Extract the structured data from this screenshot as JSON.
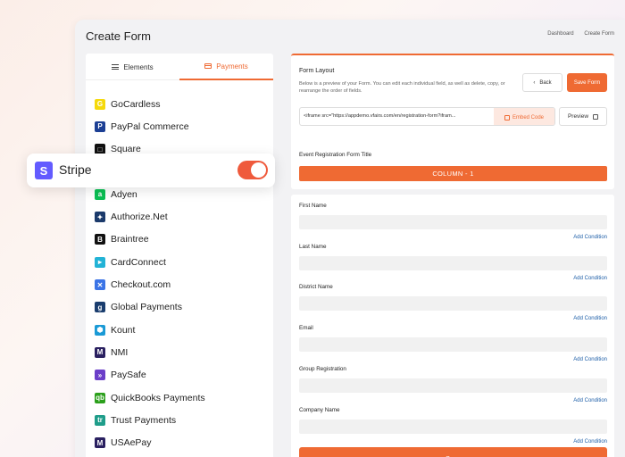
{
  "header": {
    "title": "Create Form",
    "breadcrumbs": [
      "Dashboard",
      "Create Form"
    ]
  },
  "tabs": {
    "elements": "Elements",
    "payments": "Payments"
  },
  "gateways": [
    {
      "name": "GoCardless",
      "icon": "gocardless-icon",
      "color": "#f5d90a",
      "glyph": "G"
    },
    {
      "name": "PayPal Commerce",
      "icon": "paypal-icon",
      "color": "#1c3f94",
      "glyph": "P"
    },
    {
      "name": "Square",
      "icon": "square-icon",
      "color": "#111111",
      "glyph": "□"
    },
    {
      "name": "Stripe",
      "icon": "stripe-icon",
      "color": "#635bff",
      "glyph": "S"
    },
    {
      "name": "Adyen",
      "icon": "adyen-icon",
      "color": "#0abf53",
      "glyph": "a"
    },
    {
      "name": "Authorize.Net",
      "icon": "authorize-net-icon",
      "color": "#1b3a6b",
      "glyph": "✦"
    },
    {
      "name": "Braintree",
      "icon": "braintree-icon",
      "color": "#111111",
      "glyph": "B"
    },
    {
      "name": "CardConnect",
      "icon": "cardconnect-icon",
      "color": "#22b3d6",
      "glyph": "▸"
    },
    {
      "name": "Checkout.com",
      "icon": "checkout-com-icon",
      "color": "#3b74e6",
      "glyph": "✕"
    },
    {
      "name": "Global Payments",
      "icon": "global-payments-icon",
      "color": "#1a3d6e",
      "glyph": "g"
    },
    {
      "name": "Kount",
      "icon": "kount-icon",
      "color": "#1a9ad6",
      "glyph": "⬢"
    },
    {
      "name": "NMI",
      "icon": "nmi-icon",
      "color": "#2a2060",
      "glyph": "M"
    },
    {
      "name": "PaySafe",
      "icon": "paysafe-icon",
      "color": "#6a3ec8",
      "glyph": "»"
    },
    {
      "name": "QuickBooks Payments",
      "icon": "quickbooks-icon",
      "color": "#2ca01c",
      "glyph": "qb"
    },
    {
      "name": "Trust Payments",
      "icon": "trust-payments-icon",
      "color": "#1f9d8a",
      "glyph": "tr"
    },
    {
      "name": "USAePay",
      "icon": "usaepay-icon",
      "color": "#2a2060",
      "glyph": "M"
    }
  ],
  "stripe_card": {
    "label": "Stripe",
    "glyph": "S",
    "enabled": true
  },
  "layout": {
    "title": "Form Layout",
    "description": "Below is a preview of your Form. You can edit each individual field, as well as delete, copy, or rearrange the order of fields.",
    "back_label": "Back",
    "save_form_label": "Save Form",
    "embed_code": "<iframe src=\"https://appdemo.vfairs.com/en/registration-form?ifram...",
    "embed_button": "Embed Code",
    "preview_label": "Preview",
    "form_title": "Event Registration Form Title",
    "column_label": "COLUMN - 1"
  },
  "fields": [
    {
      "label": "First Name",
      "condition": "Add Condition"
    },
    {
      "label": "Last Name",
      "condition": "Add Condition"
    },
    {
      "label": "District Name",
      "condition": "Add Condition"
    },
    {
      "label": "Email",
      "condition": "Add Condition"
    },
    {
      "label": "Group Registration",
      "condition": "Add Condition"
    },
    {
      "label": "Company Name",
      "condition": "Add Condition"
    }
  ],
  "save_label": "Save",
  "colors": {
    "accent": "#ef6a33",
    "link": "#1e5fa8",
    "stripe": "#635bff"
  }
}
